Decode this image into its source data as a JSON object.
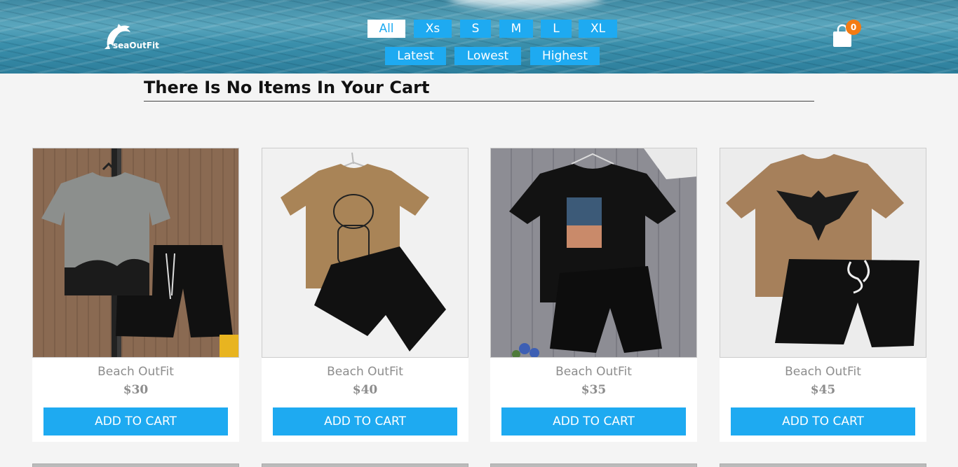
{
  "brand": {
    "name": "seaOutFit"
  },
  "filters": {
    "sizes": [
      "All",
      "Xs",
      "S",
      "M",
      "L",
      "XL"
    ],
    "active_size": "All",
    "sort": [
      "Latest",
      "Lowest",
      "Highest"
    ]
  },
  "cart": {
    "count": "0",
    "empty_message": "There Is No Items In Your Cart"
  },
  "products": [
    {
      "name": "Beach OutFit",
      "price": "$30",
      "button": "ADD TO CART"
    },
    {
      "name": "Beach OutFit",
      "price": "$40",
      "button": "ADD TO CART"
    },
    {
      "name": "Beach OutFit",
      "price": "$35",
      "button": "ADD TO CART"
    },
    {
      "name": "Beach OutFit",
      "price": "$45",
      "button": "ADD TO CART"
    }
  ],
  "colors": {
    "accent": "#1eaaf1",
    "badge": "#f37b13",
    "background": "#f4f4f4"
  }
}
